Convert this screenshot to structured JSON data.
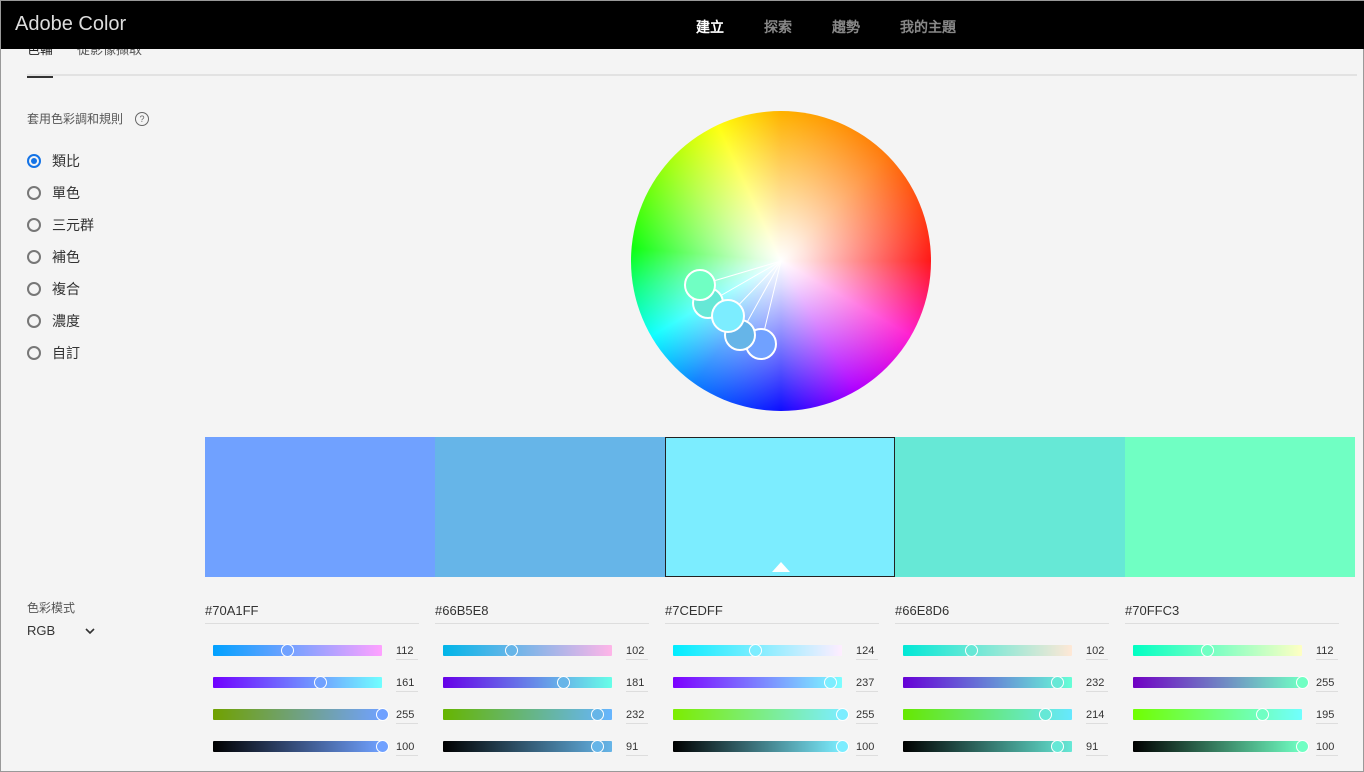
{
  "app": {
    "title": "Adobe Color"
  },
  "nav": [
    {
      "label": "建立",
      "active": true
    },
    {
      "label": "探索"
    },
    {
      "label": "趨勢"
    },
    {
      "label": "我的主題"
    }
  ],
  "subtabs": [
    {
      "label": "色輪",
      "active": true
    },
    {
      "label": "從影像擷取"
    }
  ],
  "rules": {
    "label": "套用色彩調和規則",
    "help": "?",
    "options": [
      "類比",
      "單色",
      "三元群",
      "補色",
      "複合",
      "濃度",
      "自訂"
    ],
    "selected": 0
  },
  "mode": {
    "label": "色彩模式",
    "value": "RGB"
  },
  "selected_swatch": 2,
  "swatches": [
    {
      "hex": "#70A1FF",
      "values": [
        112,
        161,
        255,
        100
      ]
    },
    {
      "hex": "#66B5E8",
      "values": [
        102,
        181,
        232,
        91
      ]
    },
    {
      "hex": "#7CEDFF",
      "values": [
        124,
        237,
        255,
        100
      ]
    },
    {
      "hex": "#66E8D6",
      "values": [
        102,
        232,
        214,
        91
      ]
    },
    {
      "hex": "#70FFC3",
      "values": [
        112,
        255,
        195,
        100
      ]
    }
  ]
}
